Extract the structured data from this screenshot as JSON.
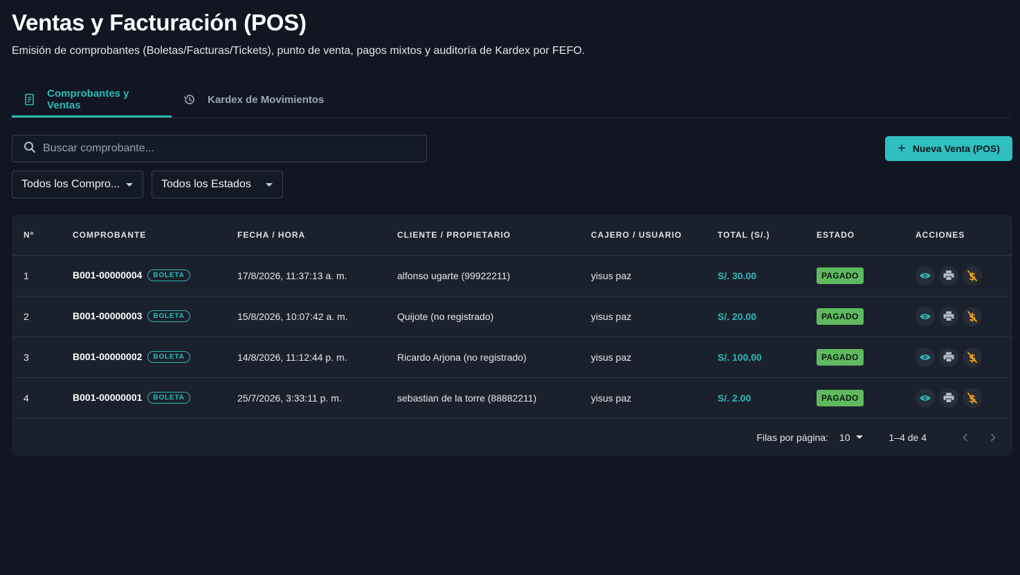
{
  "header": {
    "title": "Ventas y Facturación (POS)",
    "subtitle": "Emisión de comprobantes (Boletas/Facturas/Tickets), punto de venta, pagos mixtos y auditoría de Kardex por FEFO."
  },
  "tabs": [
    {
      "label": "Comprobantes y Ventas",
      "icon": "receipt-icon",
      "active": true
    },
    {
      "label": "Kardex de Movimientos",
      "icon": "history-icon",
      "active": false
    }
  ],
  "toolbar": {
    "search_placeholder": "Buscar comprobante...",
    "new_sale_label": "Nueva Venta (POS)",
    "filter_type": "Todos los Compro...",
    "filter_status": "Todos los Estados"
  },
  "table": {
    "headers": [
      "Nº",
      "COMPROBANTE",
      "FECHA / HORA",
      "CLIENTE / PROPIETARIO",
      "CAJERO / USUARIO",
      "TOTAL (S/.)",
      "ESTADO",
      "ACCIONES"
    ],
    "rows": [
      {
        "n": "1",
        "doc": "B001-00000004",
        "type": "BOLETA",
        "date": "17/8/2026, 11:37:13 a. m.",
        "client": "alfonso ugarte (99922211)",
        "cashier": "yisus paz",
        "total": "S/. 30.00",
        "status": "PAGADO"
      },
      {
        "n": "2",
        "doc": "B001-00000003",
        "type": "BOLETA",
        "date": "15/8/2026, 10:07:42 a. m.",
        "client": "Quijote (no registrado)",
        "cashier": "yisus paz",
        "total": "S/. 20.00",
        "status": "PAGADO"
      },
      {
        "n": "3",
        "doc": "B001-00000002",
        "type": "BOLETA",
        "date": "14/8/2026, 11:12:44 p. m.",
        "client": "Ricardo Arjona (no registrado)",
        "cashier": "yisus paz",
        "total": "S/. 100.00",
        "status": "PAGADO"
      },
      {
        "n": "4",
        "doc": "B001-00000001",
        "type": "BOLETA",
        "date": "25/7/2026, 3:33:11 p. m.",
        "client": "sebastian de la torre (88882211)",
        "cashier": "yisus paz",
        "total": "S/. 2.00",
        "status": "PAGADO"
      }
    ],
    "action_icons": [
      "view-icon",
      "print-icon",
      "void-payment-icon"
    ]
  },
  "pagination": {
    "rows_per_page_label": "Filas por página:",
    "rows_per_page": "10",
    "range": "1–4 de 4"
  },
  "colors": {
    "accent": "#2fb9b9",
    "status_paid": "#5fb95f",
    "warning": "#f0a020",
    "background": "#111622"
  }
}
